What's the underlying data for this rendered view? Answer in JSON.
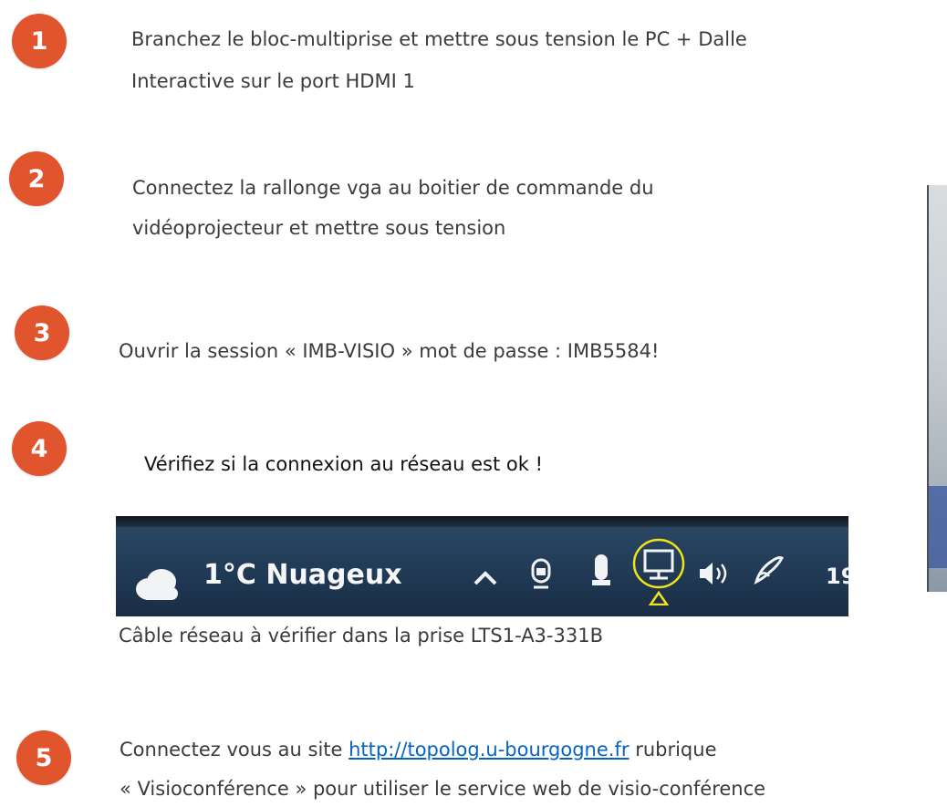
{
  "steps": [
    {
      "number": "1",
      "lines": [
        "Branchez le bloc-multiprise et mettre sous tension le PC + Dalle",
        "Interactive sur le port HDMI 1"
      ]
    },
    {
      "number": "2",
      "lines": [
        "Connectez la rallonge vga au boitier de commande du",
        "vidéoprojecteur et mettre sous tension"
      ]
    },
    {
      "number": "3",
      "lines": [
        "Ouvrir la session « IMB-VISIO » mot de passe : IMB5584!"
      ]
    },
    {
      "number": "4",
      "lines": [
        "Vérifiez si la connexion au réseau est ok !"
      ]
    },
    {
      "number": "5",
      "lines": [
        "Connectez vous au site",
        "rubrique",
        "« Visioconférence » pour utiliser le service web de visio-conférence"
      ]
    }
  ],
  "step5_link": "http://topolog.u-bourgogne.fr",
  "taskbar": {
    "weather_text": "1°C Nuageux",
    "clock_partial": "19",
    "highlight_color": "#f2e21c",
    "icons": [
      "cloud-icon",
      "chevron-up-icon",
      "meet-now-icon",
      "microphone-icon",
      "network-icon",
      "speaker-icon",
      "pen-icon"
    ]
  },
  "caption": "Câble réseau à vérifier dans la prise LTS1-A3-331B",
  "colors": {
    "step_circle": "#e0542e",
    "link": "#0563c1"
  }
}
